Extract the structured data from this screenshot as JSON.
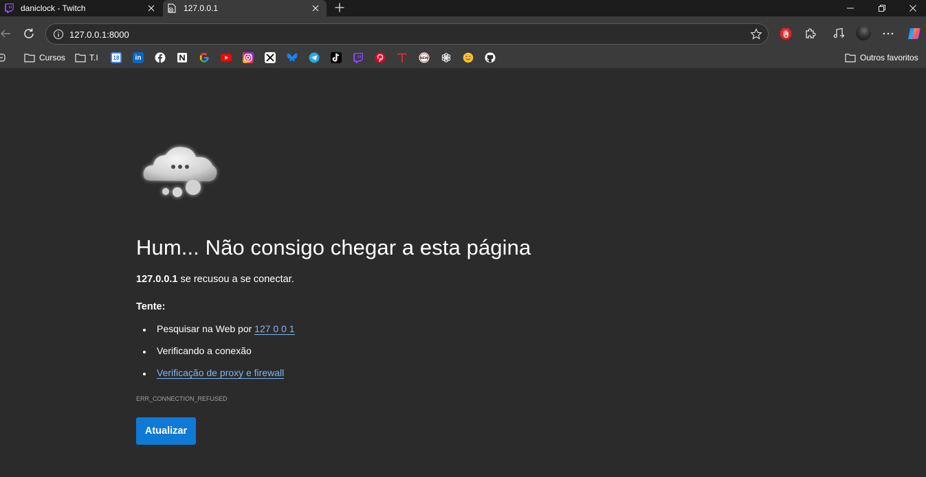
{
  "tabs": [
    {
      "title": "daniclock - Twitch",
      "active": false,
      "icon": "twitch-icon"
    },
    {
      "title": "127.0.0.1",
      "active": true,
      "icon": "broken-page-icon"
    }
  ],
  "address_bar": {
    "url": "127.0.0.1:8000"
  },
  "bookmarks": {
    "folders": [
      {
        "label": "Cursos"
      },
      {
        "label": "T.I"
      }
    ],
    "icons": [
      "calendar-icon",
      "linkedin-icon",
      "facebook-icon",
      "notion-icon",
      "google-icon",
      "youtube-icon",
      "instagram-icon",
      "x-icon",
      "bluesky-icon",
      "telegram-icon",
      "tiktok-icon",
      "twitch-icon",
      "pinterest-icon",
      "t-icon",
      "news-icon",
      "openai-icon",
      "emoji-icon",
      "github-icon"
    ],
    "calendar_number": "18",
    "linkedin_text": "in",
    "other_favorites": "Outros favoritos"
  },
  "error_page": {
    "headline": "Hum... Não consigo chegar a esta página",
    "host": "127.0.0.1",
    "refused_text": " se recusou a se conectar.",
    "try_label": "Tente:",
    "suggestion_search_prefix": "Pesquisar na Web por ",
    "suggestion_search_link": "127 0 0 1",
    "suggestion_check_connection": "Verificando a conexão",
    "suggestion_proxy_link": "Verificação de proxy e firewall",
    "error_code": "ERR_CONNECTION_REFUSED",
    "reload_button": "Atualizar"
  },
  "colors": {
    "page_bg": "#2b2b2b",
    "toolbar_bg": "#3b3b3b",
    "link": "#7fb6f2",
    "button_bg": "#0f7ad6"
  }
}
